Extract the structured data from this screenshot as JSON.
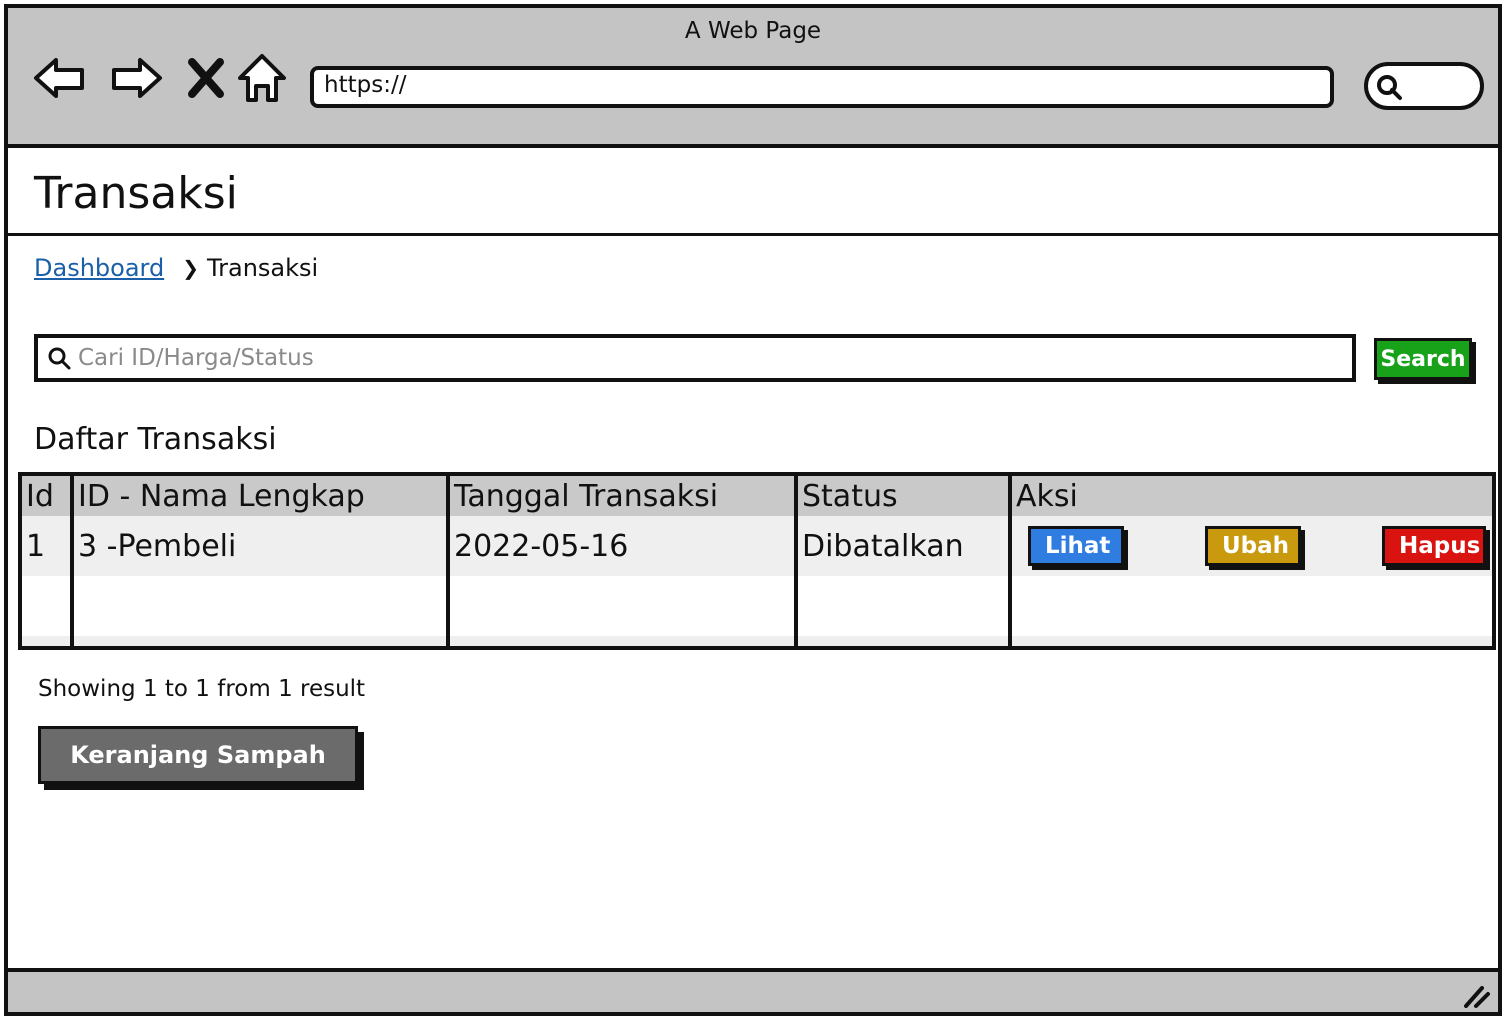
{
  "window": {
    "title": "A Web Page"
  },
  "toolbar": {
    "back_icon": "arrow-left-icon",
    "forward_icon": "arrow-right-icon",
    "stop_icon": "close-icon",
    "home_icon": "home-icon",
    "url": "https://",
    "search_icon": "search-icon"
  },
  "page": {
    "title": "Transaksi",
    "breadcrumb": {
      "link": "Dashboard",
      "current": "Transaksi"
    },
    "search": {
      "placeholder": "Cari ID/Harga/Status",
      "button": "Search"
    },
    "section_title": "Daftar Transaksi",
    "table": {
      "headers": [
        "Id",
        "ID - Nama Lengkap",
        "Tanggal Transaksi",
        "Status",
        "Aksi"
      ],
      "rows": [
        {
          "id": "1",
          "nama": "3 -Pembeli",
          "tanggal": "2022-05-16",
          "status": "Dibatalkan"
        }
      ],
      "actions": {
        "view": "Lihat",
        "edit": "Ubah",
        "delete": "Hapus"
      }
    },
    "showing": "Showing 1 to 1 from 1 result",
    "trash_button": "Keranjang Sampah"
  },
  "colors": {
    "chrome": "#c4c4c4",
    "link": "#1a5fa8",
    "search_button": "#17a21a",
    "view_button": "#2f7de1",
    "edit_button": "#c99a0e",
    "delete_button": "#d9130f",
    "trash_button": "#6b6b6b"
  }
}
